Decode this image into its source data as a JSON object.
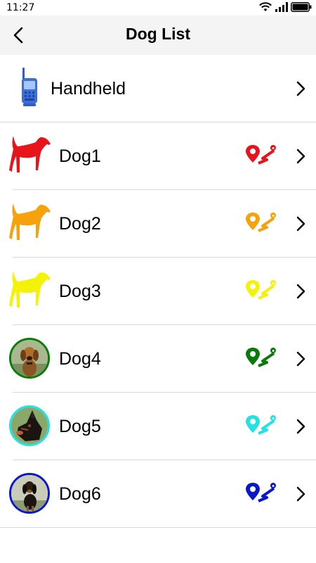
{
  "status_bar": {
    "time": "11:27",
    "icons": [
      "wifi-icon",
      "signal-icon",
      "battery-icon"
    ]
  },
  "header": {
    "title": "Dog List",
    "back_icon": "back-arrow-icon"
  },
  "items": [
    {
      "label": "Handheld",
      "kind": "handheld",
      "icon": "handheld-radio-icon",
      "color": "#3a6fd8"
    },
    {
      "label": "Dog1",
      "kind": "silhouette",
      "color": "#e8131b"
    },
    {
      "label": "Dog2",
      "kind": "silhouette",
      "color": "#f5a20c"
    },
    {
      "label": "Dog3",
      "kind": "silhouette",
      "color": "#f5f20a"
    },
    {
      "label": "Dog4",
      "kind": "photo",
      "color": "#0a7a0a"
    },
    {
      "label": "Dog5",
      "kind": "photo",
      "color": "#22e2e6"
    },
    {
      "label": "Dog6",
      "kind": "photo",
      "color": "#0a17cc"
    }
  ]
}
